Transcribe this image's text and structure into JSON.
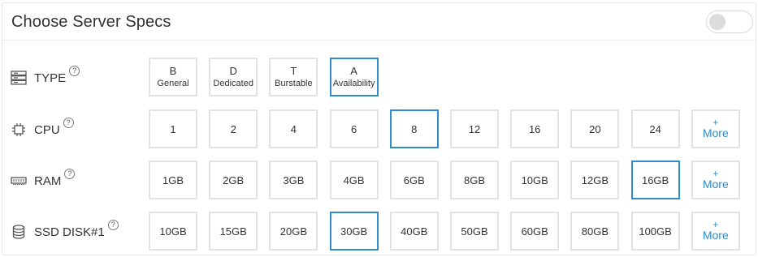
{
  "header": {
    "title": "Choose Server Specs",
    "toggle_on": false
  },
  "help_glyph": "?",
  "type": {
    "label": "TYPE",
    "icon": "server-icon",
    "options": [
      {
        "letter": "B",
        "name": "General",
        "selected": false
      },
      {
        "letter": "D",
        "name": "Dedicated",
        "selected": false
      },
      {
        "letter": "T",
        "name": "Burstable",
        "selected": false
      },
      {
        "letter": "A",
        "name": "Availability",
        "selected": true
      }
    ]
  },
  "cpu": {
    "label": "CPU",
    "icon": "cpu-chip-icon",
    "options": [
      {
        "value": "1",
        "selected": false
      },
      {
        "value": "2",
        "selected": false
      },
      {
        "value": "4",
        "selected": false
      },
      {
        "value": "6",
        "selected": false
      },
      {
        "value": "8",
        "selected": true
      },
      {
        "value": "12",
        "selected": false
      },
      {
        "value": "16",
        "selected": false
      },
      {
        "value": "20",
        "selected": false
      },
      {
        "value": "24",
        "selected": false
      }
    ]
  },
  "ram": {
    "label": "RAM",
    "icon": "memory-stick-icon",
    "options": [
      {
        "value": "1GB",
        "selected": false
      },
      {
        "value": "2GB",
        "selected": false
      },
      {
        "value": "3GB",
        "selected": false
      },
      {
        "value": "4GB",
        "selected": false
      },
      {
        "value": "6GB",
        "selected": false
      },
      {
        "value": "8GB",
        "selected": false
      },
      {
        "value": "10GB",
        "selected": false
      },
      {
        "value": "12GB",
        "selected": false
      },
      {
        "value": "16GB",
        "selected": true
      }
    ]
  },
  "disk": {
    "label": "SSD DISK#1",
    "icon": "database-icon",
    "options": [
      {
        "value": "10GB",
        "selected": false
      },
      {
        "value": "15GB",
        "selected": false
      },
      {
        "value": "20GB",
        "selected": false
      },
      {
        "value": "30GB",
        "selected": true
      },
      {
        "value": "40GB",
        "selected": false
      },
      {
        "value": "50GB",
        "selected": false
      },
      {
        "value": "60GB",
        "selected": false
      },
      {
        "value": "80GB",
        "selected": false
      },
      {
        "value": "100GB",
        "selected": false
      }
    ]
  },
  "more": {
    "plus": "+",
    "text": "More"
  },
  "colors": {
    "accent": "#2f8bc9",
    "border": "#e3e3e3",
    "text": "#333333"
  }
}
